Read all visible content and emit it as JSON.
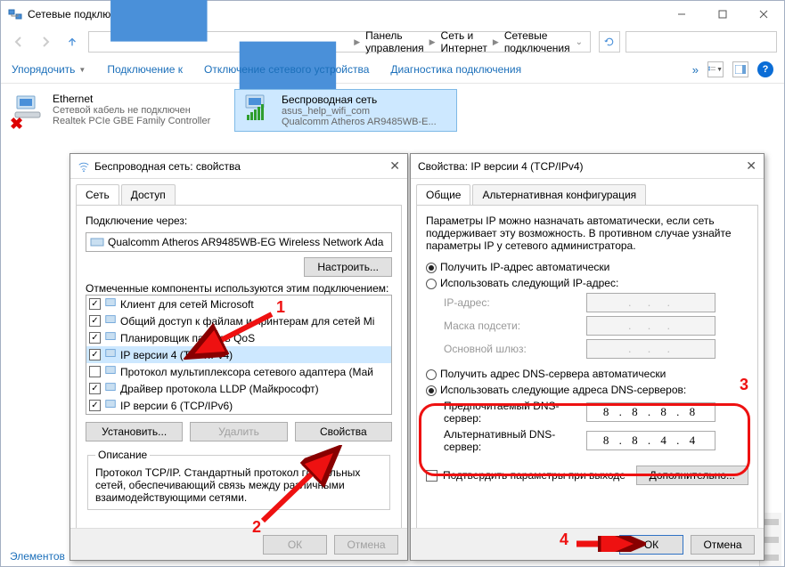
{
  "window": {
    "title": "Сетевые подключения"
  },
  "breadcrumb": [
    "Панель управления",
    "Сеть и Интернет",
    "Сетевые подключения"
  ],
  "toolbar": {
    "organize": "Упорядочить",
    "connect": "Подключение к",
    "disable": "Отключение сетевого устройства",
    "diagnose": "Диагностика подключения"
  },
  "connections": [
    {
      "name": "Ethernet",
      "status": "Сетевой кабель не подключен",
      "adapter": "Realtek PCIe GBE Family Controller",
      "type": "eth"
    },
    {
      "name": "Беспроводная сеть",
      "status": "asus_help_wifi_com",
      "adapter": "Qualcomm Atheros AR9485WB-E...",
      "type": "wifi"
    }
  ],
  "statusbar": "Элементов",
  "dlg1": {
    "title": "Беспроводная сеть: свойства",
    "tab_net": "Сеть",
    "tab_access": "Доступ",
    "conn_via": "Подключение через:",
    "adapter": "Qualcomm Atheros AR9485WB-EG Wireless Network Ada",
    "configure": "Настроить...",
    "components_label": "Отмеченные компоненты используются этим подключением:",
    "components": [
      {
        "chk": true,
        "label": "Клиент для сетей Microsoft"
      },
      {
        "chk": true,
        "label": "Общий доступ к файлам и принтерам для сетей Mi"
      },
      {
        "chk": true,
        "label": "Планировщик пакетов QoS"
      },
      {
        "chk": true,
        "label": "IP версии 4 (TCP/IPv4)",
        "selected": true
      },
      {
        "chk": false,
        "label": "Протокол мультиплексора сетевого адаптера (Май"
      },
      {
        "chk": true,
        "label": "Драйвер протокола LLDP (Майкрософт)"
      },
      {
        "chk": true,
        "label": "IP версии 6 (TCP/IPv6)"
      }
    ],
    "install": "Установить...",
    "remove": "Удалить",
    "properties": "Свойства",
    "desc_title": "Описание",
    "desc_text": "Протокол TCP/IP. Стандартный протокол глобальных сетей, обеспечивающий связь между различными взаимодействующими сетями.",
    "ok": "ОК",
    "cancel": "Отмена"
  },
  "dlg2": {
    "title": "Свойства: IP версии 4 (TCP/IPv4)",
    "tab_general": "Общие",
    "tab_alt": "Альтернативная конфигурация",
    "help": "Параметры IP можно назначать автоматически, если сеть поддерживает эту возможность. В противном случае узнайте параметры IP у сетевого администратора.",
    "ip_auto": "Получить IP-адрес автоматически",
    "ip_manual": "Использовать следующий IP-адрес:",
    "ip_label": "IP-адрес:",
    "mask_label": "Маска подсети:",
    "gw_label": "Основной шлюз:",
    "dns_auto": "Получить адрес DNS-сервера автоматически",
    "dns_manual": "Использовать следующие адреса DNS-серверов:",
    "dns1_label": "Предпочитаемый DNS-сервер:",
    "dns2_label": "Альтернативный DNS-сервер:",
    "dns1": "8 . 8 . 8 . 8",
    "dns2": "8 . 8 . 4 . 4",
    "validate": "Подтвердить параметры при выходе",
    "advanced": "Дополнительно...",
    "ok": "ОК",
    "cancel": "Отмена"
  },
  "annotations": {
    "n1": "1",
    "n2": "2",
    "n3": "3",
    "n4": "4"
  }
}
